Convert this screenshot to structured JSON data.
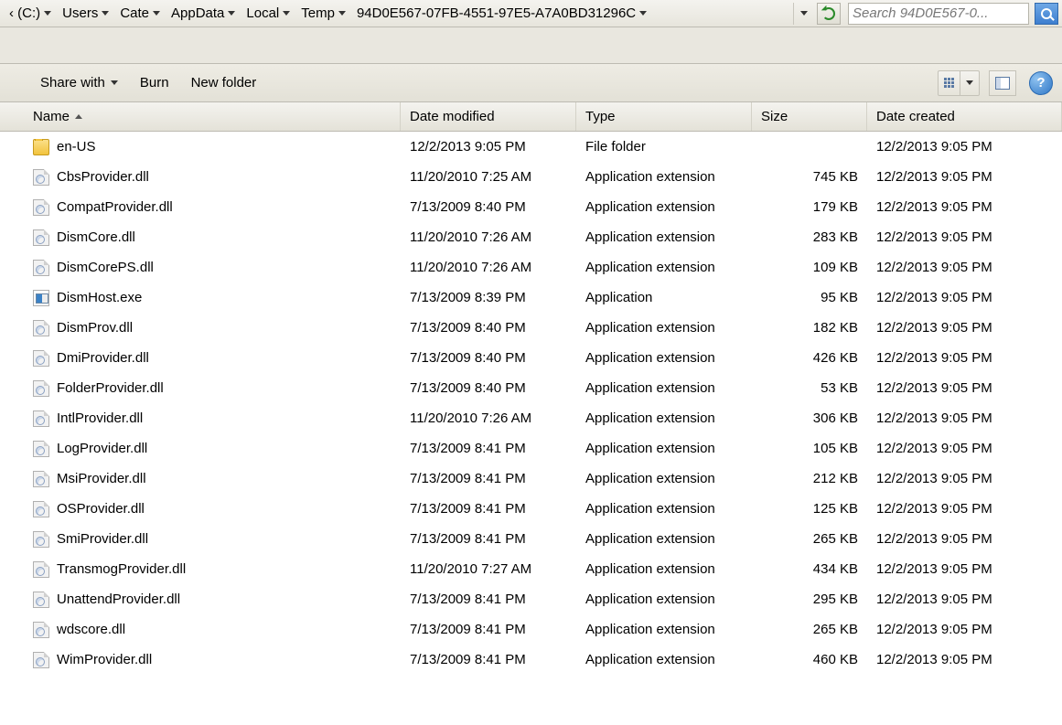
{
  "breadcrumb": [
    {
      "label": "‹ (C:)"
    },
    {
      "label": "Users"
    },
    {
      "label": "Cate"
    },
    {
      "label": "AppData"
    },
    {
      "label": "Local"
    },
    {
      "label": "Temp"
    },
    {
      "label": "94D0E567-07FB-4551-97E5-A7A0BD31296C"
    }
  ],
  "search": {
    "placeholder": "Search 94D0E567-0..."
  },
  "toolbar": {
    "share": "Share with",
    "burn": "Burn",
    "newfolder": "New folder"
  },
  "columns": {
    "name": "Name",
    "date": "Date modified",
    "type": "Type",
    "size": "Size",
    "created": "Date created"
  },
  "files": [
    {
      "icon": "folder",
      "name": "en-US",
      "date": "12/2/2013 9:05 PM",
      "type": "File folder",
      "size": "",
      "created": "12/2/2013 9:05 PM"
    },
    {
      "icon": "dll",
      "name": "CbsProvider.dll",
      "date": "11/20/2010 7:25 AM",
      "type": "Application extension",
      "size": "745 KB",
      "created": "12/2/2013 9:05 PM"
    },
    {
      "icon": "dll",
      "name": "CompatProvider.dll",
      "date": "7/13/2009 8:40 PM",
      "type": "Application extension",
      "size": "179 KB",
      "created": "12/2/2013 9:05 PM"
    },
    {
      "icon": "dll",
      "name": "DismCore.dll",
      "date": "11/20/2010 7:26 AM",
      "type": "Application extension",
      "size": "283 KB",
      "created": "12/2/2013 9:05 PM"
    },
    {
      "icon": "dll",
      "name": "DismCorePS.dll",
      "date": "11/20/2010 7:26 AM",
      "type": "Application extension",
      "size": "109 KB",
      "created": "12/2/2013 9:05 PM"
    },
    {
      "icon": "exe",
      "name": "DismHost.exe",
      "date": "7/13/2009 8:39 PM",
      "type": "Application",
      "size": "95 KB",
      "created": "12/2/2013 9:05 PM"
    },
    {
      "icon": "dll",
      "name": "DismProv.dll",
      "date": "7/13/2009 8:40 PM",
      "type": "Application extension",
      "size": "182 KB",
      "created": "12/2/2013 9:05 PM"
    },
    {
      "icon": "dll",
      "name": "DmiProvider.dll",
      "date": "7/13/2009 8:40 PM",
      "type": "Application extension",
      "size": "426 KB",
      "created": "12/2/2013 9:05 PM"
    },
    {
      "icon": "dll",
      "name": "FolderProvider.dll",
      "date": "7/13/2009 8:40 PM",
      "type": "Application extension",
      "size": "53 KB",
      "created": "12/2/2013 9:05 PM"
    },
    {
      "icon": "dll",
      "name": "IntlProvider.dll",
      "date": "11/20/2010 7:26 AM",
      "type": "Application extension",
      "size": "306 KB",
      "created": "12/2/2013 9:05 PM"
    },
    {
      "icon": "dll",
      "name": "LogProvider.dll",
      "date": "7/13/2009 8:41 PM",
      "type": "Application extension",
      "size": "105 KB",
      "created": "12/2/2013 9:05 PM"
    },
    {
      "icon": "dll",
      "name": "MsiProvider.dll",
      "date": "7/13/2009 8:41 PM",
      "type": "Application extension",
      "size": "212 KB",
      "created": "12/2/2013 9:05 PM"
    },
    {
      "icon": "dll",
      "name": "OSProvider.dll",
      "date": "7/13/2009 8:41 PM",
      "type": "Application extension",
      "size": "125 KB",
      "created": "12/2/2013 9:05 PM"
    },
    {
      "icon": "dll",
      "name": "SmiProvider.dll",
      "date": "7/13/2009 8:41 PM",
      "type": "Application extension",
      "size": "265 KB",
      "created": "12/2/2013 9:05 PM"
    },
    {
      "icon": "dll",
      "name": "TransmogProvider.dll",
      "date": "11/20/2010 7:27 AM",
      "type": "Application extension",
      "size": "434 KB",
      "created": "12/2/2013 9:05 PM"
    },
    {
      "icon": "dll",
      "name": "UnattendProvider.dll",
      "date": "7/13/2009 8:41 PM",
      "type": "Application extension",
      "size": "295 KB",
      "created": "12/2/2013 9:05 PM"
    },
    {
      "icon": "dll",
      "name": "wdscore.dll",
      "date": "7/13/2009 8:41 PM",
      "type": "Application extension",
      "size": "265 KB",
      "created": "12/2/2013 9:05 PM"
    },
    {
      "icon": "dll",
      "name": "WimProvider.dll",
      "date": "7/13/2009 8:41 PM",
      "type": "Application extension",
      "size": "460 KB",
      "created": "12/2/2013 9:05 PM"
    }
  ]
}
